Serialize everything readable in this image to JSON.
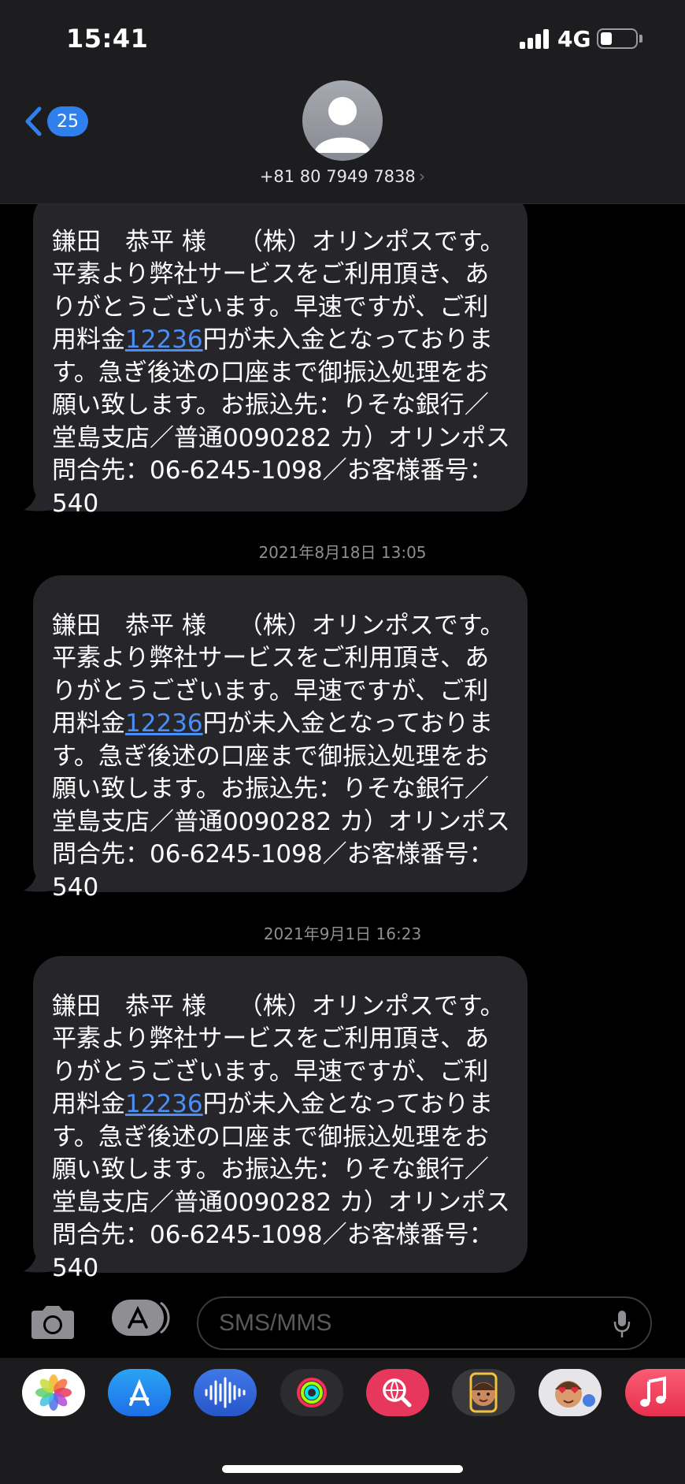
{
  "status_bar": {
    "time": "15:41",
    "network": "4G"
  },
  "header": {
    "back_badge": "25",
    "contact_number": "+81 80 7949 7838",
    "contact_chevron": "›"
  },
  "messages": [
    {
      "timestamp": "",
      "text_before": "鎌田　恭平 様　 （株）オリンポスです。平素より弊社サービスをご利用頂き、ありがとうございます。早速ですが、ご利用料金",
      "amount": "12236",
      "text_after": "円が未入金となっております。急ぎ後述の口座まで御振込処理をお願い致します。お振込先：りそな銀行／堂島支店／普通0090282 カ）オリンポス　問合先：06-6245-1098／お客様番号：540"
    },
    {
      "timestamp": "2021年8月18日 13:05",
      "text_before": "鎌田　恭平 様　 （株）オリンポスです。平素より弊社サービスをご利用頂き、ありがとうございます。早速ですが、ご利用料金",
      "amount": "12236",
      "text_after": "円が未入金となっております。急ぎ後述の口座まで御振込処理をお願い致します。お振込先：りそな銀行／堂島支店／普通0090282 カ）オリンポス　問合先：06-6245-1098／お客様番号：540"
    },
    {
      "timestamp": "2021年9月1日 16:23",
      "text_before": "鎌田　恭平 様　 （株）オリンポスです。平素より弊社サービスをご利用頂き、ありがとうございます。早速ですが、ご利用料金",
      "amount": "12236",
      "text_after": "円が未入金となっております。急ぎ後述の口座まで御振込処理をお願い致します。お振込先：りそな銀行／堂島支店／普通0090282 カ）オリンポス　問合先：06-6245-1098／お客様番号：540"
    }
  ],
  "input": {
    "placeholder": "SMS/MMS"
  },
  "icons": {
    "camera": "camera-icon",
    "app_store": "app-store-icon",
    "microphone": "microphone-icon"
  },
  "app_drawer": [
    {
      "icon": "photos-icon"
    },
    {
      "icon": "app-store-icon"
    },
    {
      "icon": "audio-waveform-icon"
    },
    {
      "icon": "fitness-activity-icon"
    },
    {
      "icon": "image-search-icon"
    },
    {
      "icon": "memoji-icon"
    },
    {
      "icon": "memoji-stickers-icon"
    },
    {
      "icon": "music-icon"
    }
  ],
  "colors": {
    "accent": "#2f80ed",
    "link": "#4b8ef5",
    "bubble": "#26262a",
    "header_bg": "#1d1d1f"
  }
}
